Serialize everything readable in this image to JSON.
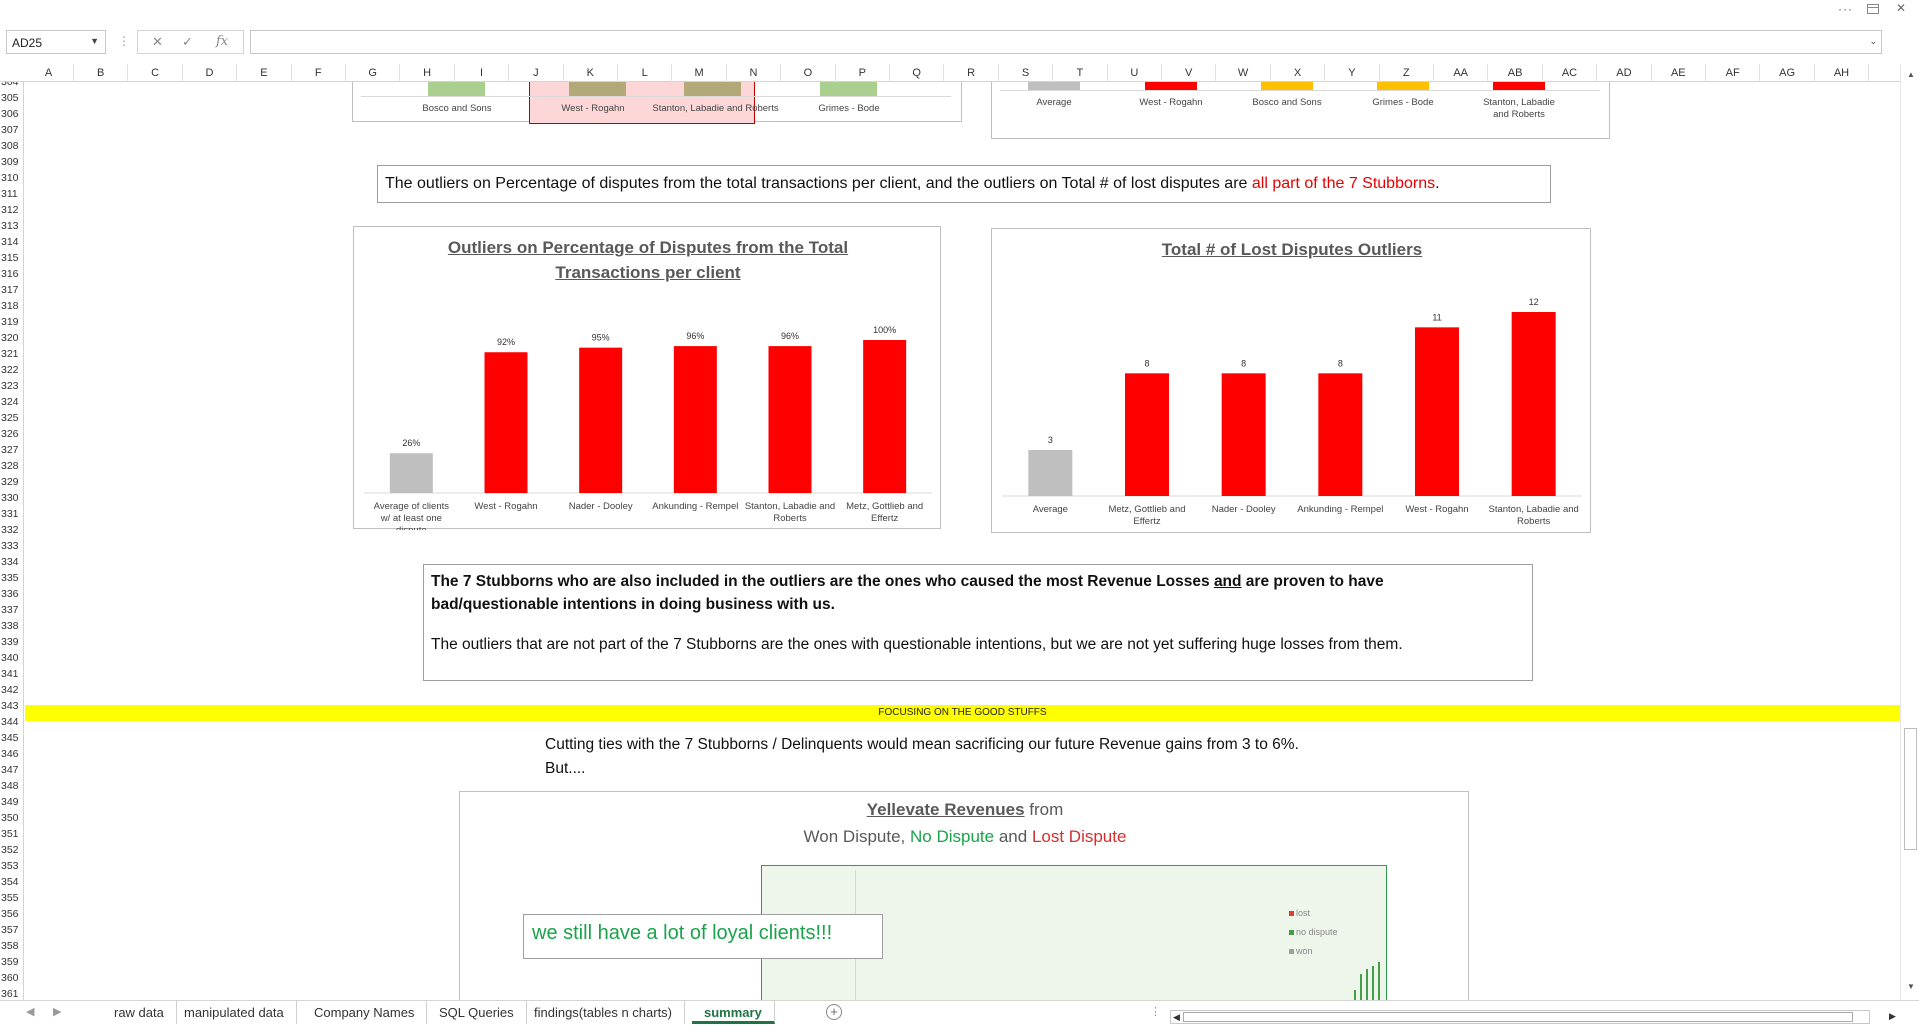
{
  "namebox": {
    "value": "AD25"
  },
  "formula": {
    "cancel_icon": "✕",
    "confirm_icon": "✓",
    "fx_icon": "fx",
    "value": ""
  },
  "columns": [
    "A",
    "B",
    "C",
    "D",
    "E",
    "F",
    "G",
    "H",
    "I",
    "J",
    "K",
    "L",
    "M",
    "N",
    "O",
    "P",
    "Q",
    "R",
    "S",
    "T",
    "U",
    "V",
    "W",
    "X",
    "Y",
    "Z",
    "AA",
    "AB",
    "AC",
    "AD",
    "AE",
    "AF",
    "AG",
    "AH"
  ],
  "rows": [
    "304",
    "305",
    "306",
    "307",
    "308",
    "309",
    "310",
    "311",
    "312",
    "313",
    "314",
    "315",
    "316",
    "317",
    "318",
    "319",
    "320",
    "321",
    "322",
    "323",
    "324",
    "325",
    "326",
    "327",
    "328",
    "329",
    "330",
    "331",
    "332",
    "333",
    "334",
    "335",
    "336",
    "337",
    "338",
    "339",
    "340",
    "341",
    "342",
    "343",
    "344",
    "345",
    "346",
    "347",
    "348",
    "349",
    "350",
    "351",
    "352",
    "353",
    "354",
    "355",
    "356",
    "357",
    "358",
    "359",
    "360",
    "361"
  ],
  "top_left_chart": {
    "labels": [
      "Bosco and Sons",
      "West - Rogahn",
      "Stanton, Labadie and Roberts",
      "Grimes - Bode"
    ]
  },
  "top_right_chart": {
    "labels": [
      "Average",
      "West - Rogahn",
      "Bosco and Sons",
      "Grimes - Bode",
      "Stanton, Labadie and Roberts"
    ]
  },
  "note1": {
    "text": "The outliers on Percentage of disputes from the total transactions per client, and the outliers on Total # of lost disputes are ",
    "highlight": "all part of the 7 Stubborns",
    "end": "."
  },
  "chart_data": [
    {
      "type": "bar",
      "title": "Outliers on Percentage of Disputes from the Total Transactions per client",
      "categories": [
        "Average of clients w/ at least one dispute",
        "West - Rogahn",
        "Nader - Dooley",
        "Ankunding - Rempel",
        "Stanton, Labadie and Roberts",
        "Metz, Gottlieb and Effertz"
      ],
      "values": [
        26,
        92,
        95,
        96,
        96,
        100
      ],
      "data_labels": [
        "26%",
        "92%",
        "95%",
        "96%",
        "96%",
        "100%"
      ],
      "colors": [
        "#bfbfbf",
        "#ff0000",
        "#ff0000",
        "#ff0000",
        "#ff0000",
        "#ff0000"
      ],
      "ylim": [
        0,
        100
      ]
    },
    {
      "type": "bar",
      "title": "Total # of Lost Disputes Outliers",
      "categories": [
        "Average",
        "Metz, Gottlieb and Effertz",
        "Nader - Dooley",
        "Ankunding - Rempel",
        "West - Rogahn",
        "Stanton, Labadie and Roberts"
      ],
      "values": [
        3,
        8,
        8,
        8,
        11,
        12
      ],
      "data_labels": [
        "3",
        "8",
        "8",
        "8",
        "11",
        "12"
      ],
      "colors": [
        "#bfbfbf",
        "#ff0000",
        "#ff0000",
        "#ff0000",
        "#ff0000",
        "#ff0000"
      ],
      "ylim": [
        0,
        12
      ]
    }
  ],
  "note2": {
    "bold_a": "The 7 Stubborns who are also included in the outliers are the ones  who caused the most Revenue Losses ",
    "bold_and": "and",
    "bold_b": " are proven to  have bad/questionable  intentions in doing business with us.",
    "normal": "The outliers that are not part of the 7 Stubborns are the ones with questionable intentions, but we are not yet suffering huge losses from them."
  },
  "banner": {
    "text": "FOCUSING ON THE GOOD STUFFS"
  },
  "cutting": {
    "line1": "Cutting ties with the 7 Stubborns / Delinquents would mean sacrificing our future Revenue gains from 3 to 6%.",
    "line2": "But...."
  },
  "revenue_chart": {
    "title_a": "Yellevate Revenues",
    "title_b": " from",
    "sub_a": "Won Dispute, ",
    "sub_b": "No Dispute",
    "sub_c": " and ",
    "sub_d": "Lost Dispute",
    "callout": "we still have a lot of loyal clients!!!",
    "legend": [
      "lost",
      "no dispute",
      "won"
    ],
    "colors": {
      "lost": "#e53935",
      "no_dispute": "#43a047",
      "won": "#9e9e9e",
      "green_text": "#1aa34a",
      "red_text": "#d32f2f"
    }
  },
  "tabs": [
    "raw data",
    "manipulated data",
    "Company Names",
    "SQL Queries",
    "findings(tables n charts)",
    "summary"
  ],
  "active_tab": "summary"
}
